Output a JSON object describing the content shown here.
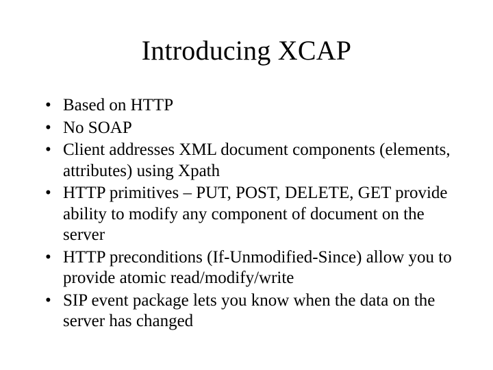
{
  "title": "Introducing XCAP",
  "bullets": [
    "Based on HTTP",
    "No SOAP",
    "Client addresses XML document components (elements, attributes) using Xpath",
    "HTTP primitives – PUT, POST, DELETE, GET provide ability to modify any component of document on the server",
    "HTTP preconditions (If-Unmodified-Since) allow you to provide atomic read/modify/write",
    "SIP event package lets you know when the data on the server has changed"
  ]
}
